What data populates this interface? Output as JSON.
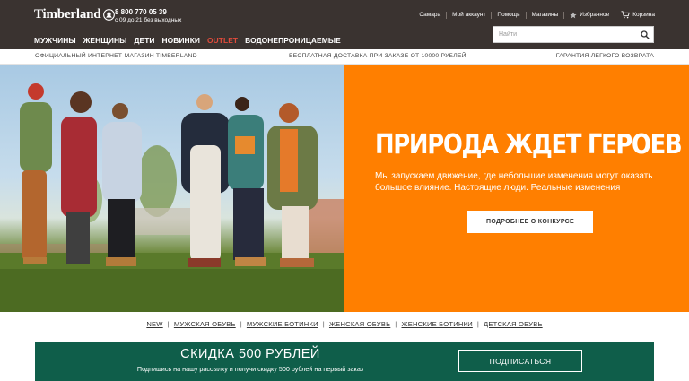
{
  "header": {
    "logo_text": "Timberland",
    "phone": "8 800 770 05 39",
    "hours": "с 09 до 21 без выходных",
    "utility": {
      "city": "Самара",
      "account": "Мой аккаунт",
      "help": "Помощь",
      "stores": "Магазины",
      "favorites": "Избранное",
      "cart": "Корзина"
    },
    "nav": [
      "МУЖЧИНЫ",
      "ЖЕНЩИНЫ",
      "ДЕТИ",
      "НОВИНКИ",
      "OUTLET",
      "ВОДОНЕПРОНИЦАЕМЫЕ"
    ],
    "search_placeholder": "Найти",
    "colors": {
      "background": "#3a3330",
      "outlet": "#e14b3b"
    }
  },
  "infobar": {
    "left": "ОФИЦИАЛЬНЫЙ ИНТЕРНЕТ-МАГАЗИН TIMBERLAND",
    "center": "БЕСПЛАТНАЯ ДОСТАВКА ПРИ ЗАКАЗЕ ОТ 10000 РУБЛЕЙ",
    "right": "ГАРАНТИЯ ЛЕГКОГО ВОЗВРАТА"
  },
  "hero": {
    "title": "ПРИРОДА ЖДЕТ ГЕРОЕВ",
    "text": "Мы запускаем движение, где небольшие изменения могут оказать большое влияние. Настоящие люди. Реальные изменения",
    "button": "ПОДРОБНЕЕ О КОНКУРСЕ",
    "color": "#ff7f00"
  },
  "category_links": [
    "NEW",
    "МУЖСКАЯ ОБУВЬ",
    "МУЖСКИЕ БОТИНКИ",
    "ЖЕНСКАЯ ОБУВЬ",
    "ЖЕНСКИЕ БОТИНКИ",
    "ДЕТСКАЯ ОБУВЬ"
  ],
  "promo": {
    "title": "СКИДКА 500 РУБЛЕЙ",
    "subtitle": "Подпишись на нашу рассылку и получи скидку 500 рублей на первый заказ",
    "button": "ПОДПИСАТЬСЯ",
    "color": "#0f5e4a"
  }
}
